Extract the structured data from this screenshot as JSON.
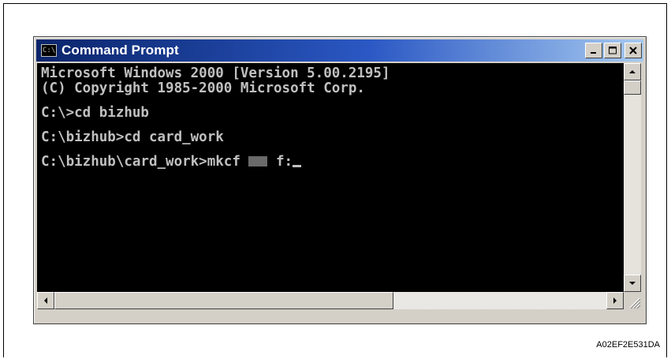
{
  "window": {
    "title": "Command Prompt",
    "icon": "console-icon",
    "icon_glyph": "C:\\"
  },
  "caption_buttons": {
    "minimize": "minimize-icon",
    "maximize": "maximize-icon",
    "close": "close-icon"
  },
  "console": {
    "lines": [
      "Microsoft Windows 2000 [Version 5.00.2195]",
      "(C) Copyright 1985-2000 Microsoft Corp.",
      "C:\\>cd bizhub",
      "C:\\bizhub>cd card_work"
    ],
    "prompt": "C:\\bizhub\\card_work>mkcf",
    "argument_after_redaction": "f:"
  },
  "colors": {
    "console_bg": "#000000",
    "console_fg": "#c0c0c0",
    "titlebar_start": "#0a246a",
    "titlebar_end": "#a6caf0",
    "window_face": "#d4d0c8"
  },
  "figure_id": "A02EF2E531DA"
}
